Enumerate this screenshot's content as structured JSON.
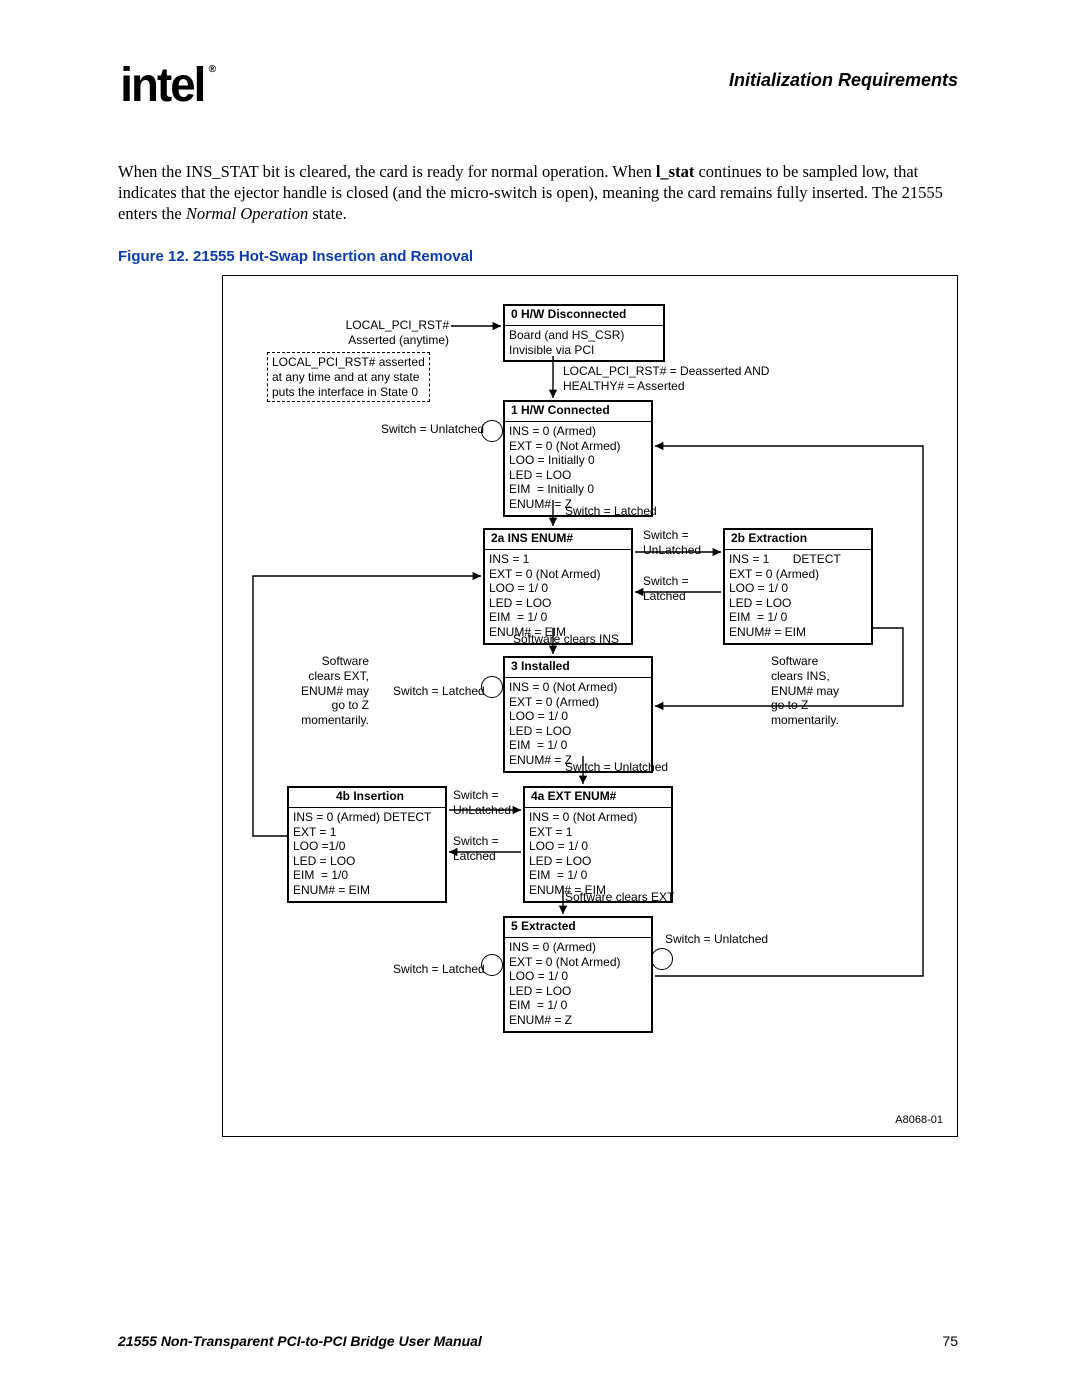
{
  "header": {
    "logo": "intel",
    "section": "Initialization Requirements"
  },
  "paragraph": {
    "pre": "When the INS_STAT bit is cleared, the card is ready for normal operation. When ",
    "bold1": "l_stat",
    "mid": " continues to be sampled low, that indicates that the ejector handle is closed (and the micro-switch is open), meaning the card remains fully inserted. The 21555 enters the ",
    "ital": "Normal Operation",
    "post": " state."
  },
  "figure_caption": "Figure 12. 21555 Hot-Swap Insertion and Removal",
  "diagram": {
    "reset_label": "LOCAL_PCI_RST#\nAsserted (anytime)",
    "reset_note": "LOCAL_PCI_RST# asserted\nat any time and at any state\nputs the interface in State 0",
    "arrow_0_1": "LOCAL_PCI_RST# = Deasserted AND\nHEALTHY# = Asserted",
    "switch_unlatched": "Switch = Unlatched",
    "switch_latched": "Switch = Latched",
    "switch_unlatched2": "Switch =\nUnLatched",
    "switch_latched2": "Switch =\nLatched",
    "sw_clears_ins": "Software clears INS",
    "sw_clears_ext": "Software clears EXT",
    "node0": {
      "title": "0 H/W Disconnected",
      "body": "Board (and HS_CSR)\nInvisible via PCI"
    },
    "node1": {
      "title": "1 H/W Connected",
      "body": "INS = 0 (Armed)\nEXT = 0 (Not Armed)\nLOO = Initially 0\nLED = LOO\nEIM  = Initially 0\nENUM# = Z"
    },
    "node2a": {
      "title": "2a INS ENUM#",
      "body": "INS = 1\nEXT = 0 (Not Armed)\nLOO = 1/ 0\nLED = LOO\nEIM  = 1/ 0\nENUM# = EIM"
    },
    "node2b": {
      "title": "2b Extraction",
      "body": "INS = 1       DETECT\nEXT = 0 (Armed)\nLOO = 1/ 0\nLED = LOO\nEIM  = 1/ 0\nENUM# = EIM"
    },
    "detect2b": "DETECT",
    "left_note": "Software\nclears EXT,\nENUM# may\ngo to Z\nmomentarily.",
    "right_note": "Software\nclears INS,\nENUM# may\ngo to Z\nmomentarily.",
    "node3": {
      "title": "3 Installed",
      "body": "INS = 0 (Not Armed)\nEXT = 0 (Armed)\nLOO = 1/ 0\nLED = LOO\nEIM  = 1/ 0\nENUM# = Z"
    },
    "node4b": {
      "title": "4b Insertion",
      "body": "INS = 0 (Armed) DETECT\nEXT = 1\nLOO =1/0\nLED = LOO\nEIM  = 1/0\nENUM# = EIM"
    },
    "detect4b": "DETECT",
    "node4a": {
      "title": "4a EXT ENUM#",
      "body": "INS = 0 (Not Armed)\nEXT = 1\nLOO = 1/ 0\nLED = LOO\nEIM  = 1/ 0\nENUM# = EIM"
    },
    "node5": {
      "title": "5 Extracted",
      "body": "INS = 0 (Armed)\nEXT = 0 (Not Armed)\nLOO = 1/ 0\nLED = LOO\nEIM  = 1/ 0\nENUM# = Z"
    },
    "art_id": "A8068-01"
  },
  "footer": {
    "left": "21555 Non-Transparent PCI-to-PCI Bridge User Manual",
    "right": "75"
  }
}
